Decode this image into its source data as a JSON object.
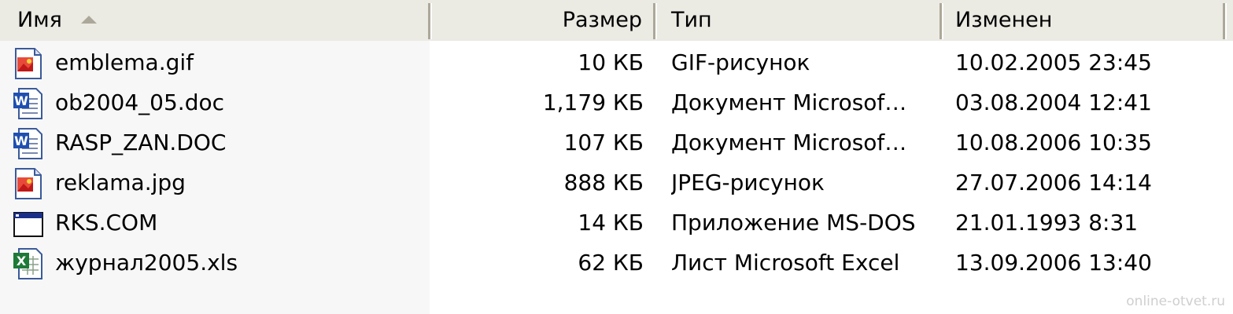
{
  "columns": {
    "name": "Имя",
    "size": "Размер",
    "type": "Тип",
    "modified": "Изменен"
  },
  "files": [
    {
      "icon": "image-file-icon",
      "name": "emblema.gif",
      "size": "10 КБ",
      "type": "GIF-рисунок",
      "modified": "10.02.2005 23:45"
    },
    {
      "icon": "word-document-icon",
      "name": "ob2004_05.doc",
      "size": "1,179 КБ",
      "type": "Документ Microsof…",
      "modified": "03.08.2004 12:41"
    },
    {
      "icon": "word-document-icon",
      "name": "RASP_ZAN.DOC",
      "size": "107 КБ",
      "type": "Документ Microsof…",
      "modified": "10.08.2006 10:35"
    },
    {
      "icon": "image-file-icon",
      "name": "reklama.jpg",
      "size": "888 КБ",
      "type": "JPEG-рисунок",
      "modified": "27.07.2006 14:14"
    },
    {
      "icon": "ms-dos-app-icon",
      "name": "RKS.COM",
      "size": "14 КБ",
      "type": "Приложение MS-DOS",
      "modified": "21.01.1993 8:31"
    },
    {
      "icon": "excel-sheet-icon",
      "name": "журнал2005.xls",
      "size": "62 КБ",
      "type": "Лист Microsoft Excel",
      "modified": "13.09.2006 13:40"
    }
  ],
  "watermark": "online-otvet.ru",
  "colors": {
    "header_bg": "#ebeae3",
    "separator": "#aca899",
    "name_column_bg": "#f7f7f7"
  }
}
